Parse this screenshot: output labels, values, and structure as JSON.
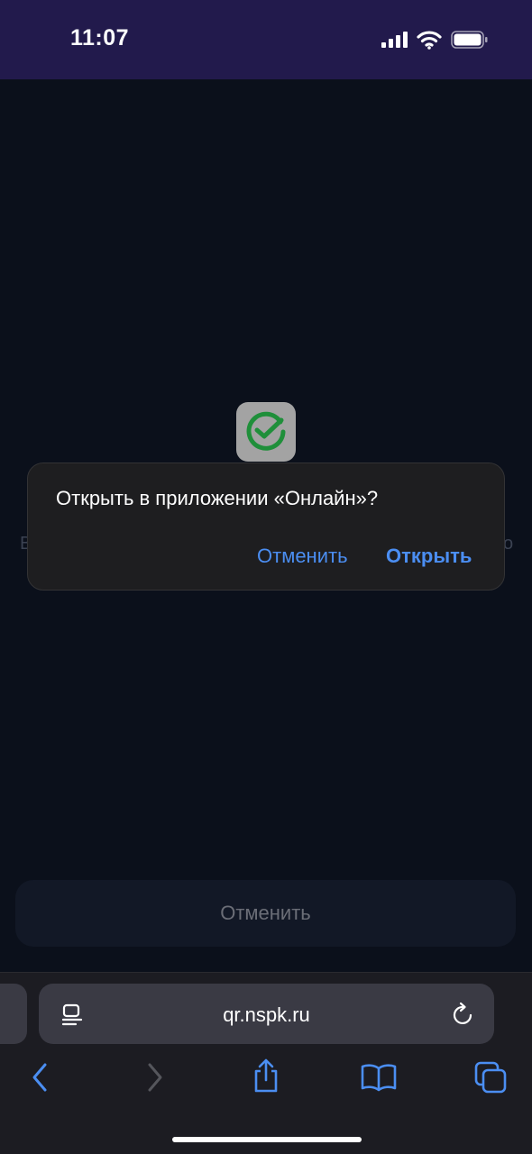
{
  "status_bar": {
    "time": "11:07"
  },
  "page": {
    "edge_left_text": "В",
    "edge_right_text": "о",
    "cancel_button_label": "Отменить"
  },
  "dialog": {
    "title": "Открыть в приложении «Онлайн»?",
    "cancel_label": "Отменить",
    "open_label": "Открыть"
  },
  "address_bar": {
    "url": "qr.nspk.ru"
  },
  "colors": {
    "status_bar_bg": "#221a4c",
    "page_bg": "#0b101b",
    "accent_blue": "#4b8ef2",
    "app_icon_green": "#1f8f3a"
  },
  "icons": {
    "app": "sber-check-icon",
    "toolbar": [
      "back-icon",
      "forward-icon",
      "share-icon",
      "bookmarks-icon",
      "tabs-icon"
    ]
  }
}
